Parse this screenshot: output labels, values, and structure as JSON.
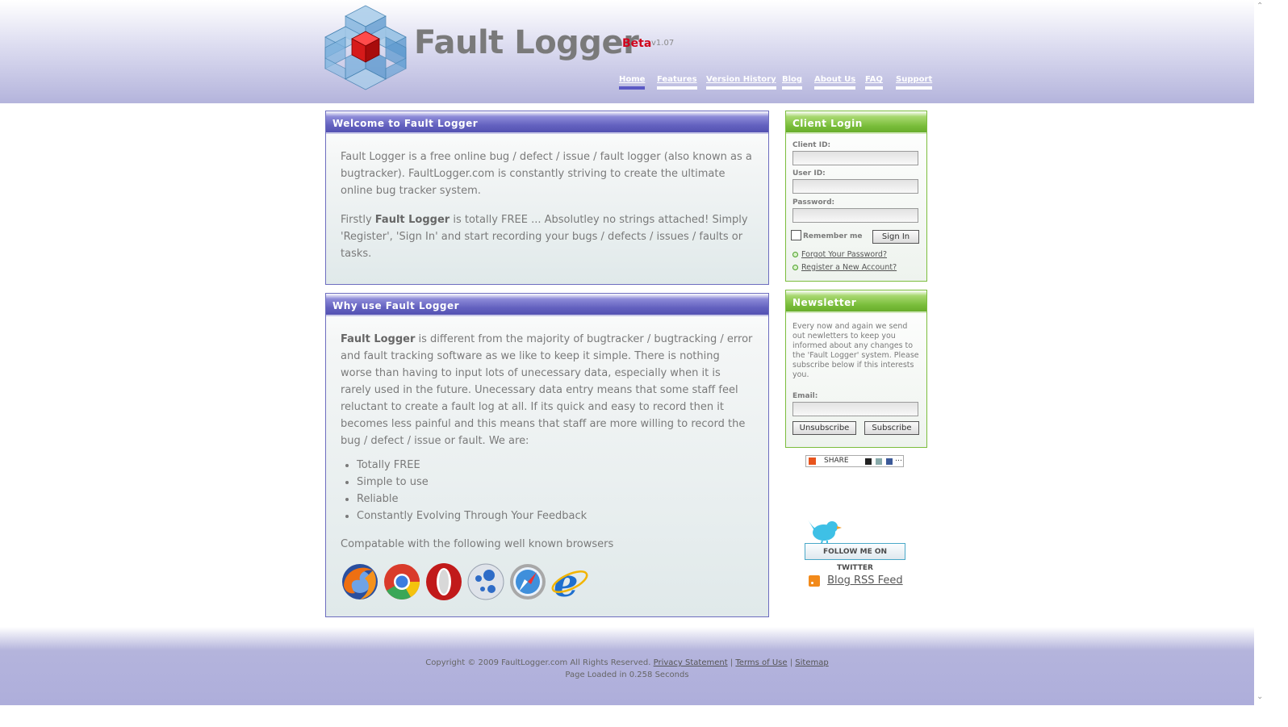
{
  "brand": {
    "name": "Fault Logger",
    "beta": "Beta",
    "version": "v1.07"
  },
  "nav": [
    {
      "label": "Home",
      "active": true
    },
    {
      "label": "Features"
    },
    {
      "label": "Version History"
    },
    {
      "label": "Blog"
    },
    {
      "label": "About Us"
    },
    {
      "label": "FAQ"
    },
    {
      "label": "Support"
    }
  ],
  "welcome": {
    "title": "Welcome to Fault Logger",
    "p1": "Fault Logger is a free online bug / defect / issue / fault logger (also known as a bugtracker). FaultLogger.com is constantly striving to create the ultimate online bug tracker system.",
    "p2_prefix": "Firstly ",
    "p2_bold": "Fault Logger",
    "p2_suffix": " is totally FREE ... Absolutley no strings attached! Simply 'Register', 'Sign In' and start recording your bugs / defects / issues / faults or tasks."
  },
  "why": {
    "title": "Why use Fault Logger",
    "p1_bold": "Fault Logger",
    "p1_rest": " is different from the majority of bugtracker / bugtracking / error and fault tracking software as we like to keep it simple. There is nothing worse than having to input lots of unecessary data, especially when it is rarely used in the future. Unecessary data entry means that some staff feel reluctant to create a fault log at all. If its quick and easy to record then it becomes less painful and this means that staff are more willing to record the bug / defect / issue or fault. We are:",
    "bullets": [
      "Totally FREE",
      "Simple to use",
      "Reliable",
      "Constantly Evolving Through Your Feedback"
    ],
    "browsers_caption": "Compatable with the following well known browsers",
    "browser_icons": [
      "firefox-icon",
      "chrome-icon",
      "opera-icon",
      "flock-icon",
      "safari-icon",
      "internet-explorer-icon"
    ]
  },
  "login": {
    "title": "Client Login",
    "client_id_label": "Client ID:",
    "user_id_label": "User ID:",
    "password_label": "Password:",
    "remember_label": "Remember me",
    "sign_in": "Sign In",
    "forgot": "Forgot Your Password?",
    "register": "Register a New Account?"
  },
  "newsletter": {
    "title": "Newsletter",
    "text": "Every now and again we send out newletters to keep you informed about any changes to the 'Fault Logger' system. Please subscribe below if this interests you.",
    "email_label": "Email:",
    "unsubscribe": "Unsubscribe",
    "subscribe": "Subscribe"
  },
  "share": {
    "label": "SHARE"
  },
  "twitter": {
    "label": "FOLLOW ME ON TWITTER"
  },
  "rss": {
    "label": "Blog RSS Feed"
  },
  "footer": {
    "copyright": "Copyright © 2009 FaultLogger.com All Rights Reserved.",
    "privacy": "Privacy Statement",
    "terms": "Terms of Use",
    "sitemap": "Sitemap",
    "sep": "|",
    "loaded": "Page Loaded in 0.258 Seconds"
  },
  "colors": {
    "accent_purple": "#6462c0",
    "accent_green": "#79bd3a",
    "beta_red": "#d0021b"
  }
}
